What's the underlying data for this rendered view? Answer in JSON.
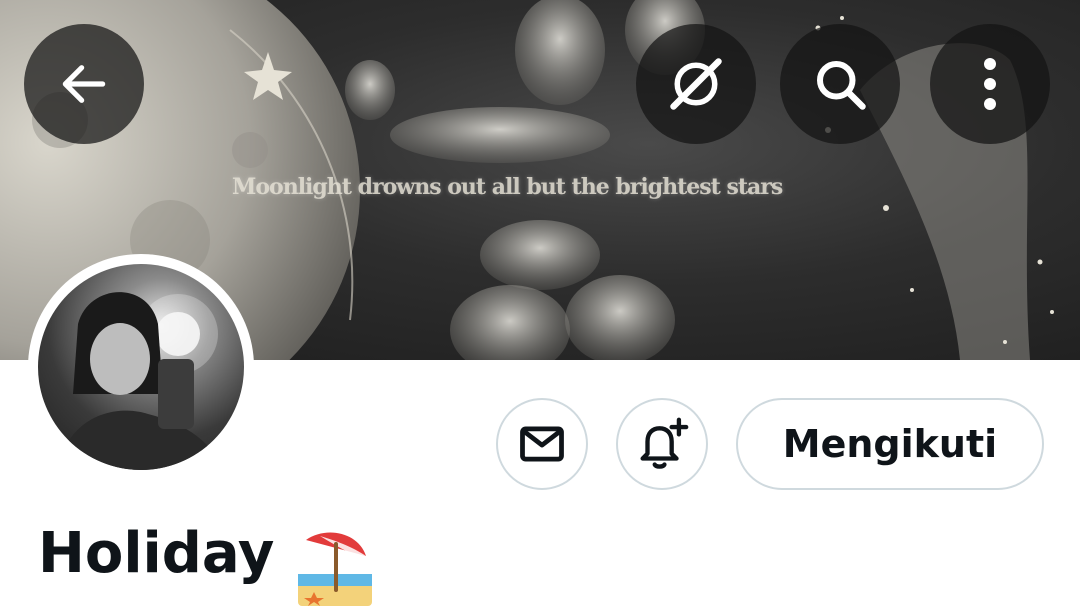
{
  "banner": {
    "quote": "Moonlight drowns out all but the brightest stars"
  },
  "header": {
    "back_icon": "arrow-left-icon",
    "grok_icon": "grok-slash-icon",
    "search_icon": "search-icon",
    "more_icon": "more-vertical-icon"
  },
  "profile": {
    "display_name": "Holiday",
    "name_emoji": "beach-with-umbrella",
    "follow_label": "Mengikuti",
    "message_icon": "envelope-icon",
    "notify_icon": "bell-plus-icon"
  },
  "colors": {
    "text": "#0f1419",
    "border": "#cfd9de",
    "overlay": "#141414"
  }
}
